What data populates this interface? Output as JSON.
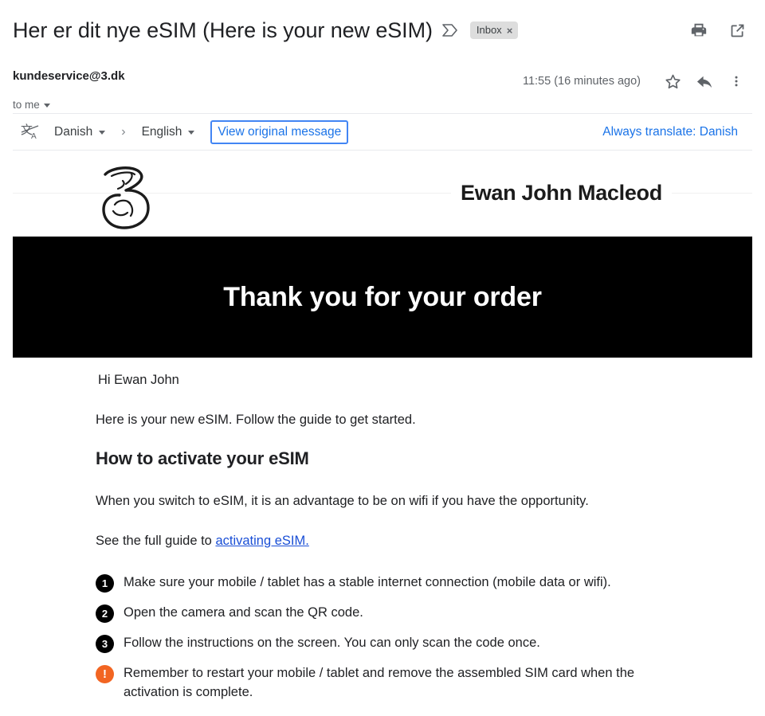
{
  "header": {
    "subject": "Her er dit nye eSIM (Here is your new eSIM)",
    "importance_icon": "importance-marker-icon",
    "label_chip": {
      "text": "Inbox",
      "remove": "×"
    },
    "actions": [
      {
        "name": "print-icon",
        "tooltip": "Print all"
      },
      {
        "name": "open-in-new-window-icon",
        "tooltip": "In new window"
      }
    ]
  },
  "sender": {
    "email": "kundeservice@3.dk",
    "timestamp": "11:55 (16 minutes ago)",
    "to_line": "to me",
    "actions": [
      {
        "name": "star-icon",
        "tooltip": "Not starred"
      },
      {
        "name": "reply-icon",
        "tooltip": "Reply"
      },
      {
        "name": "more-options-icon",
        "tooltip": "More"
      }
    ]
  },
  "translate": {
    "icon": "translate-icon",
    "source_language": "Danish",
    "separator": "›",
    "target_language": "English",
    "view_original": "View original message",
    "always_translate": "Always translate: Danish",
    "focus_color": "#4285f4",
    "link_color": "#1a73e8"
  },
  "email": {
    "brand_logo": "three-logo",
    "brand_name": "Ewan John Macleod",
    "hero": {
      "text": "Thank you for your order",
      "background": "#000000",
      "color": "#ffffff"
    },
    "greeting": "Hi Ewan John",
    "intro": "Here is your new eSIM. Follow the guide to get started.",
    "heading": "How to activate your eSIM",
    "wifi_note": "When you switch to eSIM, it is an advantage to be on wifi if you have the opportunity.",
    "guide_prefix": "See the full guide to ",
    "guide_link": "activating eSIM.",
    "steps": [
      {
        "badge": "1",
        "kind": "number",
        "text": "Make sure your mobile / tablet has a stable internet connection (mobile data or wifi)."
      },
      {
        "badge": "2",
        "kind": "number",
        "text": "Open the camera and scan the QR code."
      },
      {
        "badge": "3",
        "kind": "number",
        "text": "Follow the instructions on the screen. You can only scan the code once."
      },
      {
        "badge": "!",
        "kind": "warning",
        "text": "Remember to restart your mobile / tablet and remove the assembled SIM card when the activation is complete."
      }
    ],
    "warning_color": "#f26522",
    "link_color": "#1a4fd6"
  }
}
